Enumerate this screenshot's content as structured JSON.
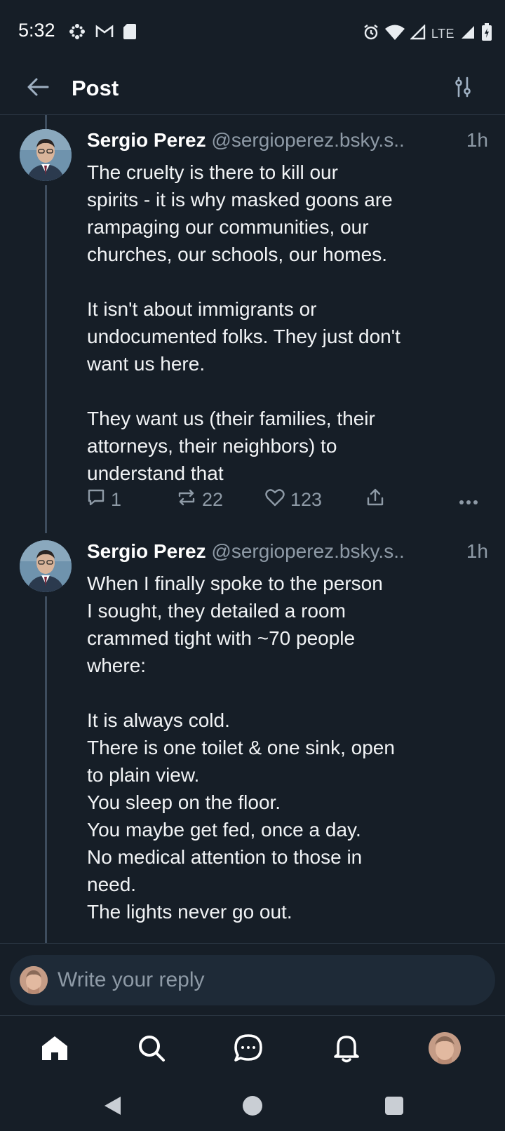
{
  "status_bar": {
    "time": "5:32",
    "network": "LTE",
    "left_icons": [
      "pinwheel-icon",
      "gmail-icon",
      "sd-card-icon"
    ],
    "right_icons": [
      "alarm-icon",
      "wifi-icon",
      "signal-icon",
      "signal-icon",
      "battery-charging-icon"
    ]
  },
  "header": {
    "title": "Post",
    "back_icon": "arrow-left-icon",
    "filter_icon": "sliders-icon"
  },
  "posts": [
    {
      "author": "Sergio Perez",
      "handle": "@sergioperez.bsky.s..",
      "time": "1h",
      "text": "The cruelty is there to kill our\nspirits - it is why masked goons are\nrampaging our communities, our\nchurches, our schools, our homes.\n\nIt isn't about immigrants or\nundocumented folks. They just don't\nwant us here.\n\nThey want us (their families, their\nattorneys, their neighbors) to\nunderstand that",
      "replies": "1",
      "reposts": "22",
      "likes": "123"
    },
    {
      "author": "Sergio Perez",
      "handle": "@sergioperez.bsky.s..",
      "time": "1h",
      "text": "When I finally spoke to the person\nI sought, they detailed a room\ncrammed tight with ~70 people\nwhere:\n\nIt is always cold.\nThere is one toilet & one sink, open\nto plain view.\nYou sleep on the floor.\nYou maybe get fed, once a day.\nNo medical attention to those in\nneed.\nThe lights never go out."
    }
  ],
  "reply_bar": {
    "placeholder": "Write your reply"
  },
  "bottom_nav": [
    "home-icon",
    "search-icon",
    "chat-icon",
    "bell-icon",
    "profile-avatar"
  ],
  "system_nav": [
    "back-triangle-icon",
    "home-circle-icon",
    "recents-square-icon"
  ],
  "colors": {
    "background": "#161e27",
    "text": "#f1f3f5",
    "muted": "#8e9aa6",
    "divider": "#2c3744",
    "input_bg": "#1e2a37"
  }
}
